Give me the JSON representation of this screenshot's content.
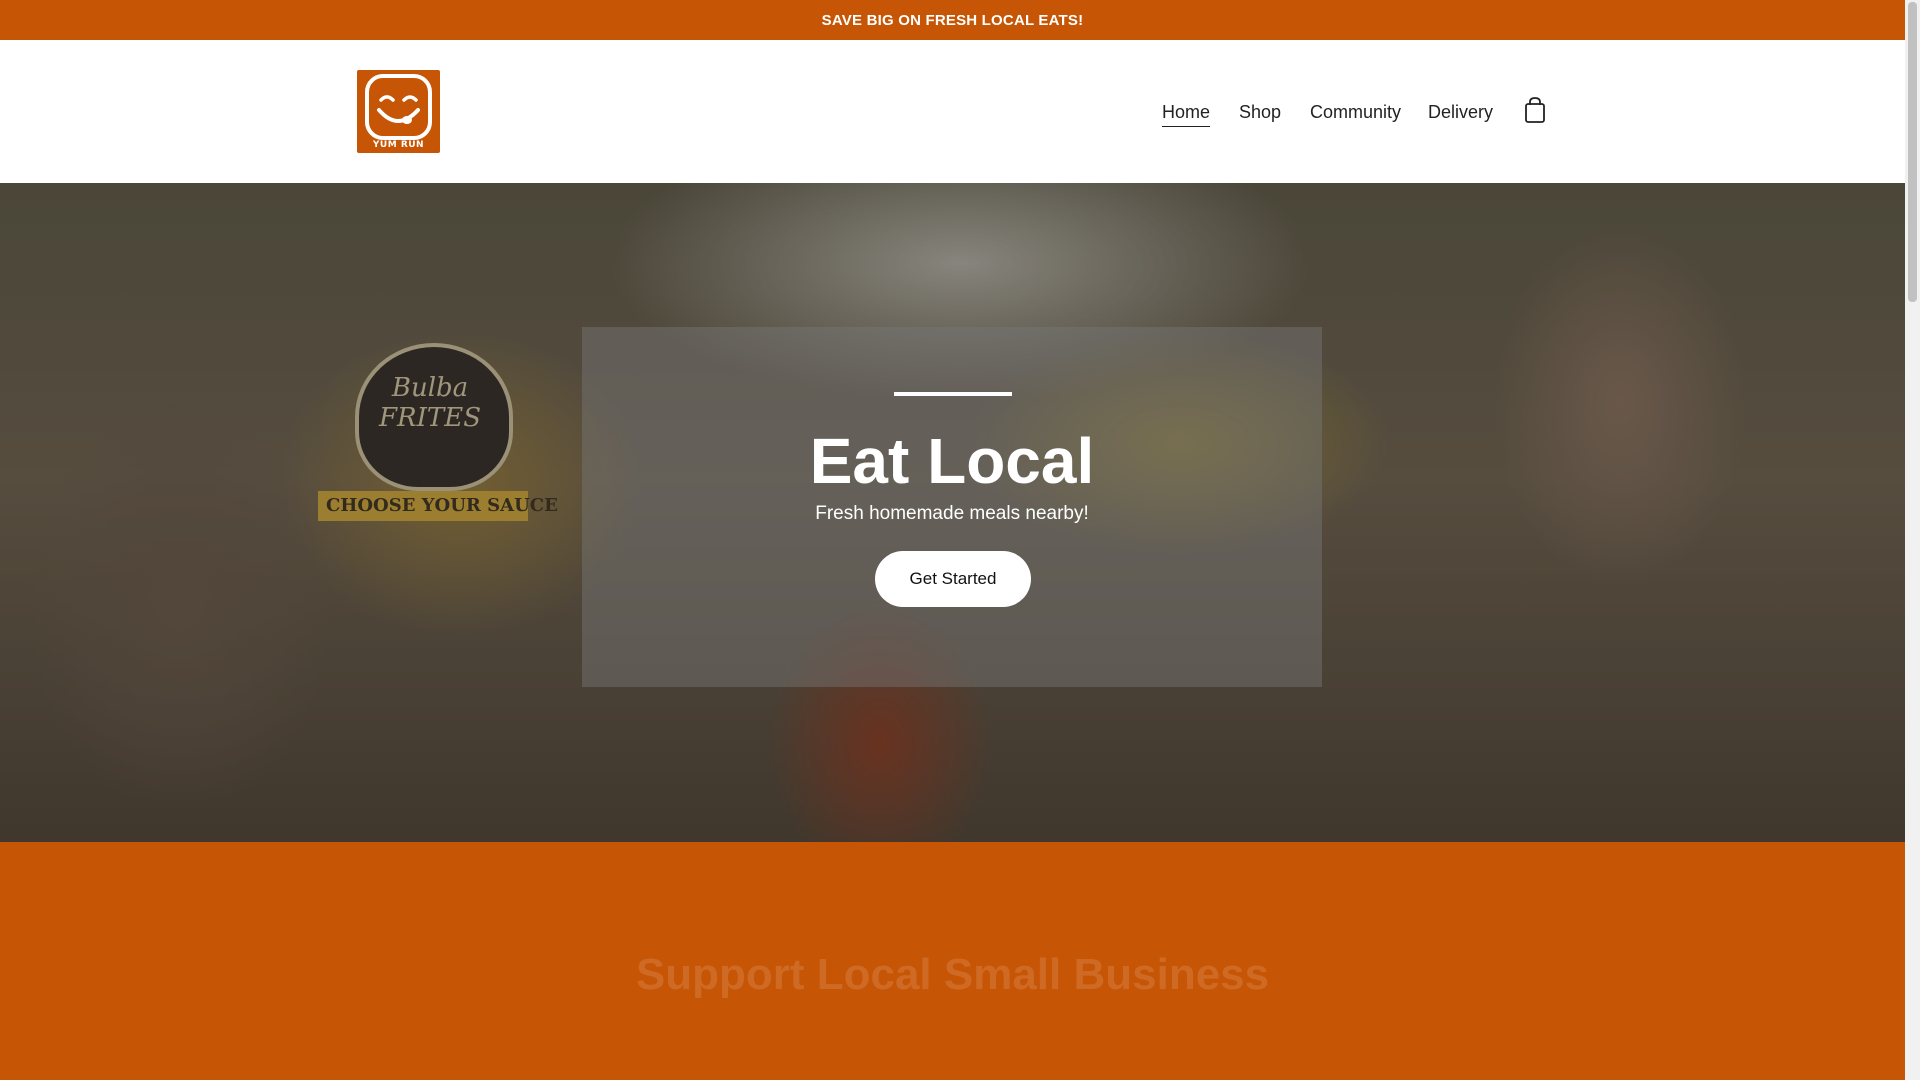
{
  "announcement": {
    "text": "SAVE BIG ON FRESH LOCAL EATS!"
  },
  "brand": {
    "logo_text": "YUM RUN",
    "color": "#c65505"
  },
  "nav": {
    "items": [
      {
        "label": "Home",
        "active": true
      },
      {
        "label": "Shop",
        "active": false
      },
      {
        "label": "Community",
        "active": false
      },
      {
        "label": "Delivery",
        "active": false
      }
    ],
    "cart_icon": "shopping-bag-icon"
  },
  "hero": {
    "title": "Eat Local",
    "subtitle": "Fresh homemade meals nearby!",
    "cta_label": "Get Started",
    "photo_sign_text": "Bulba FRITES",
    "photo_strip_text": "CHOOSE YOUR SAUCE"
  },
  "section": {
    "title": "Support Local Small Business"
  }
}
